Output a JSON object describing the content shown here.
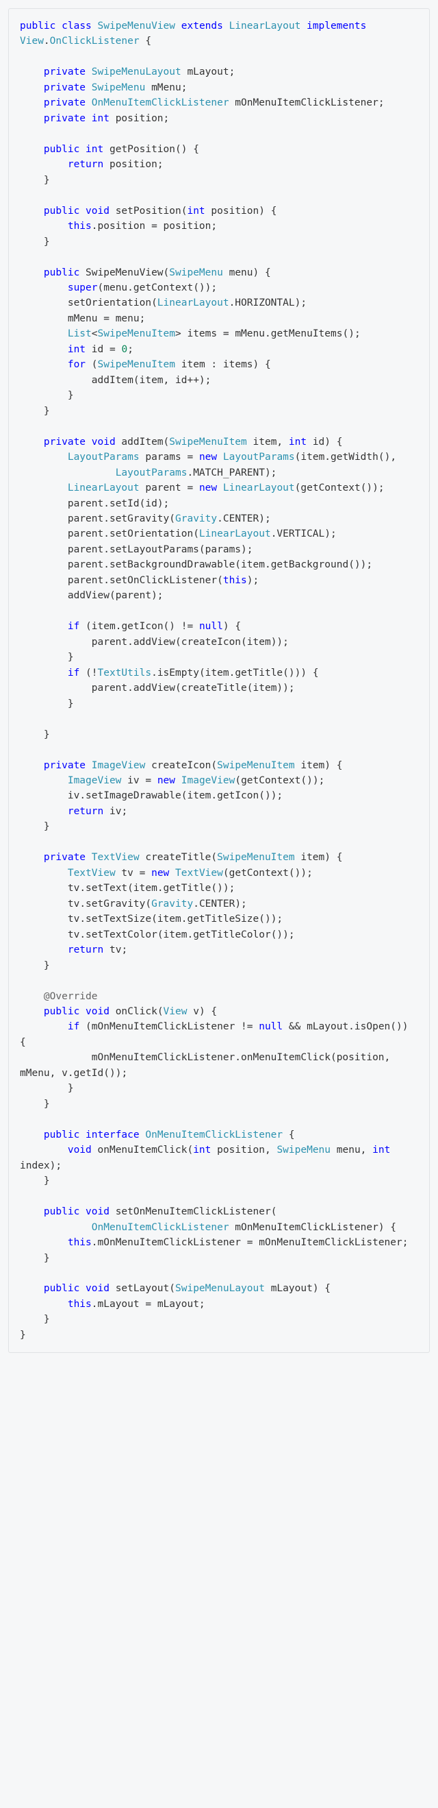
{
  "code": {
    "l1a": "public",
    "l1b": "class",
    "l1c": "SwipeMenuView",
    "l1d": "extends",
    "l1e": "LinearLayout",
    "l1f": "implements",
    "l1g": "View",
    "l1h": "OnClickListener",
    "l2a": "private",
    "l2b": "SwipeMenuLayout",
    "l2c": "mLayout",
    "l3a": "SwipeMenu",
    "l3b": "mMenu",
    "l4a": "OnMenuItemClickListener",
    "l4b": "mOnMenuItemClickListener",
    "l5a": "int",
    "l5b": "position",
    "l6a": "getPosition",
    "l7a": "return",
    "l8a": "void",
    "l8b": "setPosition",
    "l9a": "this",
    "l10a": "SwipeMenuView",
    "l10b": "menu",
    "l11a": "super",
    "l11b": "getContext",
    "l12a": "setOrientation",
    "l12b": "HORIZONTAL",
    "l13a": "List",
    "l13b": "SwipeMenuItem",
    "l13c": "items",
    "l13d": "getMenuItems",
    "l14a": "id",
    "l14b": "0",
    "l15a": "for",
    "l15b": "item",
    "l16a": "addItem",
    "l17a": "LayoutParams",
    "l17b": "params",
    "l17c": "new",
    "l17d": "getWidth",
    "l18a": "MATCH_PARENT",
    "l19a": "parent",
    "l20a": "setId",
    "l21a": "setGravity",
    "l21b": "Gravity",
    "l21c": "CENTER",
    "l22a": "VERTICAL",
    "l23a": "setLayoutParams",
    "l24a": "setBackgroundDrawable",
    "l24b": "getBackground",
    "l25a": "setOnClickListener",
    "l26a": "addView",
    "l27a": "if",
    "l27b": "getIcon",
    "l27c": "null",
    "l28a": "createIcon",
    "l29a": "TextUtils",
    "l29b": "isEmpty",
    "l29c": "getTitle",
    "l30a": "createTitle",
    "l31a": "ImageView",
    "l32a": "iv",
    "l33a": "setImageDrawable",
    "l34a": "TextView",
    "l35a": "tv",
    "l36a": "setText",
    "l37a": "setTextSize",
    "l37b": "getTitleSize",
    "l38a": "setTextColor",
    "l38b": "getTitleColor",
    "l39a": "@Override",
    "l40a": "onClick",
    "l40b": "v",
    "l41a": "isOpen",
    "l42a": "onMenuItemClick",
    "l42b": "getId",
    "l43a": "interface",
    "l44a": "index",
    "l45a": "setOnMenuItemClickListener",
    "l46a": "setLayout"
  }
}
